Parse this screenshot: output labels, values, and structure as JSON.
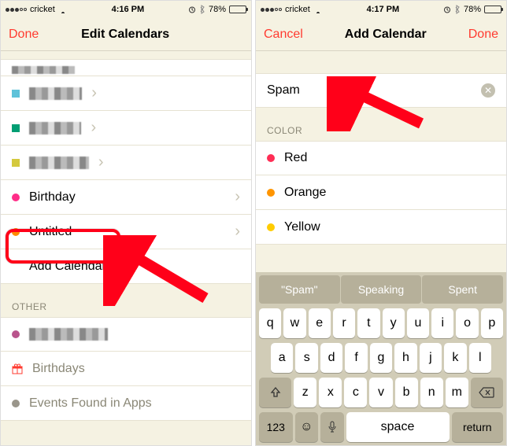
{
  "statusbar": {
    "carrier": "cricket",
    "time_left": "4:16 PM",
    "time_right": "4:17 PM",
    "battery_pct_left": "78%",
    "battery_pct_right": "78%"
  },
  "left": {
    "done": "Done",
    "title": "Edit Calendars",
    "rows": [
      {
        "color": "#5fc2d9",
        "pixelated": true
      },
      {
        "color": "#009e73",
        "pixelated": true
      },
      {
        "color": "#d4c93e",
        "pixelated": true
      },
      {
        "color": "#ff2d88",
        "label": "Birthday"
      },
      {
        "color": "#ff8a00",
        "label": "Untitled"
      }
    ],
    "add_label": "Add Calendar...",
    "other_header": "OTHER",
    "other_rows": [
      {
        "color": "#b9548c",
        "pixelated": true
      },
      {
        "icon": "gift",
        "label": "Birthdays"
      },
      {
        "color": "#9a968b",
        "label": "Events Found in Apps"
      }
    ]
  },
  "right": {
    "cancel": "Cancel",
    "done": "Done",
    "title": "Add Calendar",
    "input_value": "Spam",
    "color_header": "COLOR",
    "colors": [
      {
        "hex": "#ff2d55",
        "name": "Red"
      },
      {
        "hex": "#ff9500",
        "name": "Orange"
      },
      {
        "hex": "#ffcc00",
        "name": "Yellow"
      }
    ],
    "suggestions": [
      "\"Spam\"",
      "Speaking",
      "Spent"
    ],
    "keys_r1": [
      "q",
      "w",
      "e",
      "r",
      "t",
      "y",
      "u",
      "i",
      "o",
      "p"
    ],
    "keys_r2": [
      "a",
      "s",
      "d",
      "f",
      "g",
      "h",
      "j",
      "k",
      "l"
    ],
    "keys_r3": [
      "z",
      "x",
      "c",
      "v",
      "b",
      "n",
      "m"
    ],
    "key_123": "123",
    "key_space": "space",
    "key_return": "return"
  }
}
